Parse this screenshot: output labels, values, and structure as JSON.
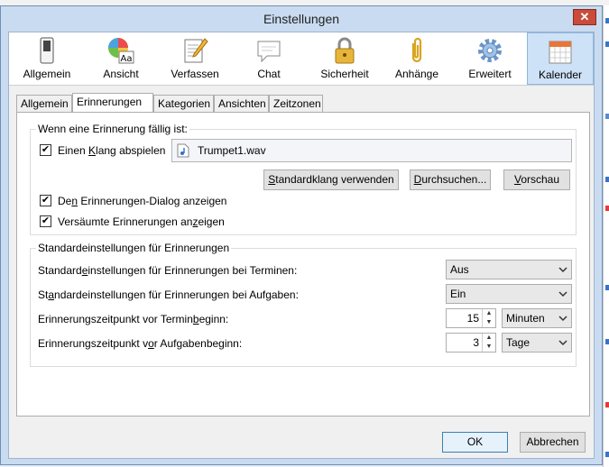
{
  "window": {
    "title": "Einstellungen",
    "close_glyph": "✕"
  },
  "toolbar": {
    "items": [
      {
        "label": "Allgemein",
        "icon": "switch-icon"
      },
      {
        "label": "Ansicht",
        "icon": "palette-icon"
      },
      {
        "label": "Verfassen",
        "icon": "compose-icon"
      },
      {
        "label": "Chat",
        "icon": "chat-icon"
      },
      {
        "label": "Sicherheit",
        "icon": "lock-icon"
      },
      {
        "label": "Anhänge",
        "icon": "paperclip-icon"
      },
      {
        "label": "Erweitert",
        "icon": "gear-icon"
      },
      {
        "label": "Kalender",
        "icon": "calendar-icon"
      }
    ],
    "selected": "Kalender"
  },
  "tabs": {
    "items": [
      "Allgemein",
      "Erinnerungen",
      "Kategorien",
      "Ansichten",
      "Zeitzonen"
    ],
    "selected": "Erinnerungen"
  },
  "reminder_due": {
    "title": "Wenn eine Erinnerung fällig ist:",
    "play_sound": {
      "pre": "Einen ",
      "acc": "K",
      "post": "lang abspielen",
      "checked": true
    },
    "sound_file": "Trumpet1.wav",
    "btn_default": {
      "pre": "",
      "acc": "S",
      "post": "tandardklang verwenden"
    },
    "btn_browse": {
      "pre": "",
      "acc": "D",
      "post": "urchsuchen..."
    },
    "btn_preview": {
      "pre": "",
      "acc": "V",
      "post": "orschau"
    },
    "show_dialog": {
      "pre": "De",
      "acc": "n",
      "post": " Erinnerungen-Dialog anzeigen",
      "checked": true
    },
    "show_missed": {
      "pre": "Versäumte Erinnerungen an",
      "acc": "z",
      "post": "eigen",
      "checked": true
    }
  },
  "defaults": {
    "title": "Standardeinstellungen für Erinnerungen",
    "events": {
      "label_pre": "Standard",
      "label_acc": "e",
      "label_post": "instellungen für Erinnerungen bei Terminen:",
      "value": "Aus"
    },
    "tasks": {
      "label_pre": "St",
      "label_acc": "a",
      "label_post": "ndardeinstellungen für Erinnerungen bei Aufgaben:",
      "value": "Ein"
    },
    "event_start": {
      "label_pre": "Erinnerungszeitpunkt vor Termin",
      "label_acc": "b",
      "label_post": "eginn:",
      "value": "15",
      "unit": "Minuten"
    },
    "task_start": {
      "label_pre": "Erinnerungszeitpunkt v",
      "label_acc": "o",
      "label_post": "r Aufgabenbeginn:",
      "value": "3",
      "unit": "Tage"
    }
  },
  "footer": {
    "ok": "OK",
    "cancel": "Abbrechen"
  }
}
